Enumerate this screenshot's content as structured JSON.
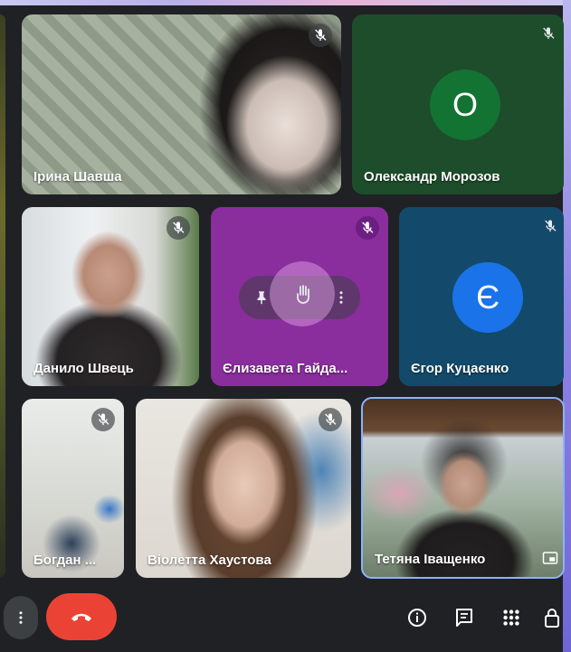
{
  "participants": [
    {
      "name": "Ірина Шавша",
      "video": true,
      "muted": true
    },
    {
      "name": "Олександр Морозов",
      "video": false,
      "muted": true,
      "initial": "О",
      "tile_color": "#1e4d2b",
      "avatar_color": "#137333"
    },
    {
      "name": "Данило Швець",
      "video": true,
      "muted": true
    },
    {
      "name": "Єлизавета Гайда...",
      "video": false,
      "muted": true,
      "tile_color": "#8a2d9d",
      "hover_actions": [
        "pin-icon",
        "hand-icon",
        "more-vert-icon"
      ]
    },
    {
      "name": "Єгор Куцаєнко",
      "video": false,
      "muted": true,
      "initial": "Є",
      "tile_color": "#134a6b",
      "avatar_color": "#1a73e8"
    },
    {
      "name": "Богдан ...",
      "video": true,
      "muted": true
    },
    {
      "name": "Віолетта Хаустова",
      "video": true,
      "muted": true
    },
    {
      "name": "Тетяна Іващенко",
      "video": true,
      "muted": false,
      "selected": true
    }
  ],
  "controls": {
    "left": [
      "more-vert-icon",
      "end-call-icon"
    ],
    "right": [
      "info-icon",
      "chat-icon",
      "activities-icon",
      "host-controls-icon"
    ]
  },
  "colors": {
    "background": "#202124",
    "end_call": "#ea4335",
    "selected_border": "#8ab4f8"
  }
}
